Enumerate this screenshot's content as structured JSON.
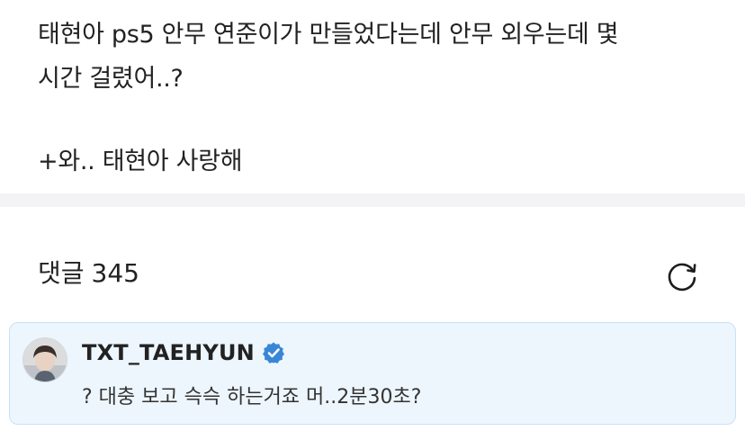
{
  "post": {
    "line1": "태현아 ps5 안무 연준이가 만들었다는데 안무 외우는데 몇",
    "line2": "시간 걸렸어..?",
    "line3": "+와.. 태현아 사랑해"
  },
  "comments": {
    "label": "댓글",
    "count": "345",
    "refresh_icon": "refresh-icon"
  },
  "artist_comment": {
    "author": "TXT_TAEHYUN",
    "verified_icon": "verified-badge-icon",
    "text": "? 대충 보고 슥슥 하는거죠 머..2분30초?"
  },
  "colors": {
    "verified_blue": "#3a86d6",
    "highlight_bg": "#edf6fd",
    "highlight_border": "#c9e1f6",
    "divider": "#f3f3f5"
  }
}
